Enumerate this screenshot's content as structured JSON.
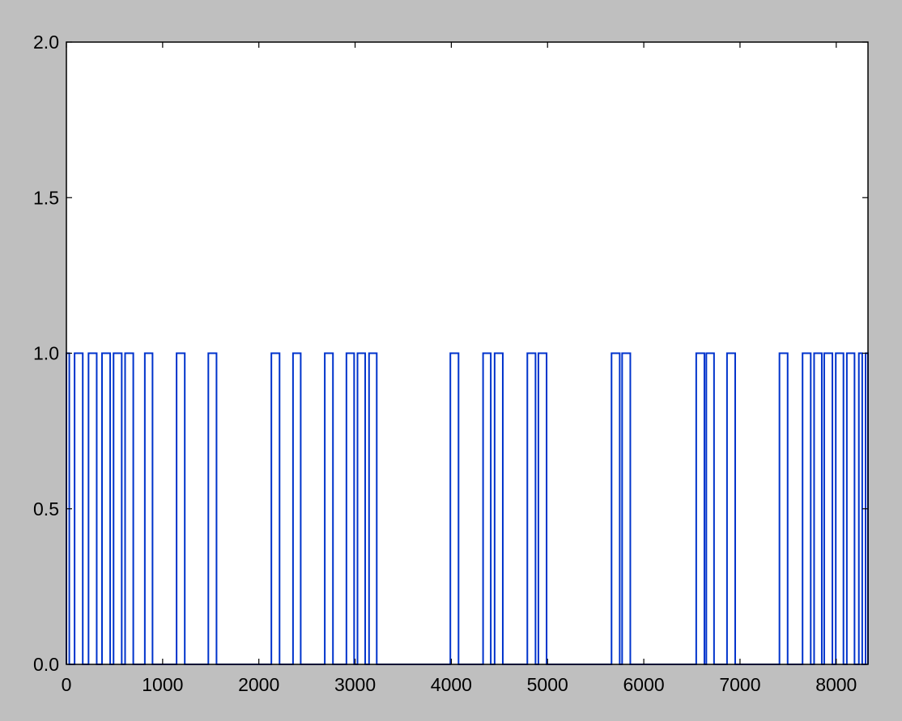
{
  "chart_data": {
    "type": "line",
    "style": "step",
    "title": "",
    "xlabel": "",
    "ylabel": "",
    "xlim": [
      0,
      8330
    ],
    "ylim": [
      0,
      2.0
    ],
    "xticks": [
      0,
      1000,
      2000,
      3000,
      4000,
      5000,
      6000,
      7000,
      8000
    ],
    "xtick_labels": [
      "0",
      "1000",
      "2000",
      "3000",
      "4000",
      "5000",
      "6000",
      "7000",
      "8000"
    ],
    "yticks": [
      0.0,
      0.5,
      1.0,
      1.5,
      2.0
    ],
    "ytick_labels": [
      "0.0",
      "0.5",
      "1.0",
      "1.5",
      "2.0"
    ],
    "grid": false,
    "series": [
      {
        "color": "#0033cc",
        "pulses": [
          [
            0,
            30
          ],
          [
            85,
            170
          ],
          [
            230,
            315
          ],
          [
            370,
            455
          ],
          [
            490,
            575
          ],
          [
            610,
            695
          ],
          [
            815,
            895
          ],
          [
            1145,
            1230
          ],
          [
            1475,
            1560
          ],
          [
            2130,
            2215
          ],
          [
            2355,
            2435
          ],
          [
            2685,
            2770
          ],
          [
            2910,
            2990
          ],
          [
            3025,
            3105
          ],
          [
            3145,
            3225
          ],
          [
            3990,
            4075
          ],
          [
            4330,
            4410
          ],
          [
            4450,
            4535
          ],
          [
            4790,
            4875
          ],
          [
            4905,
            4990
          ],
          [
            5665,
            5750
          ],
          [
            5775,
            5860
          ],
          [
            6545,
            6630
          ],
          [
            6650,
            6730
          ],
          [
            6865,
            6950
          ],
          [
            7410,
            7495
          ],
          [
            7650,
            7735
          ],
          [
            7770,
            7850
          ],
          [
            7875,
            7960
          ],
          [
            7995,
            8075
          ],
          [
            8110,
            8190
          ],
          [
            8235,
            8270
          ],
          [
            8305,
            8330
          ]
        ]
      }
    ]
  }
}
